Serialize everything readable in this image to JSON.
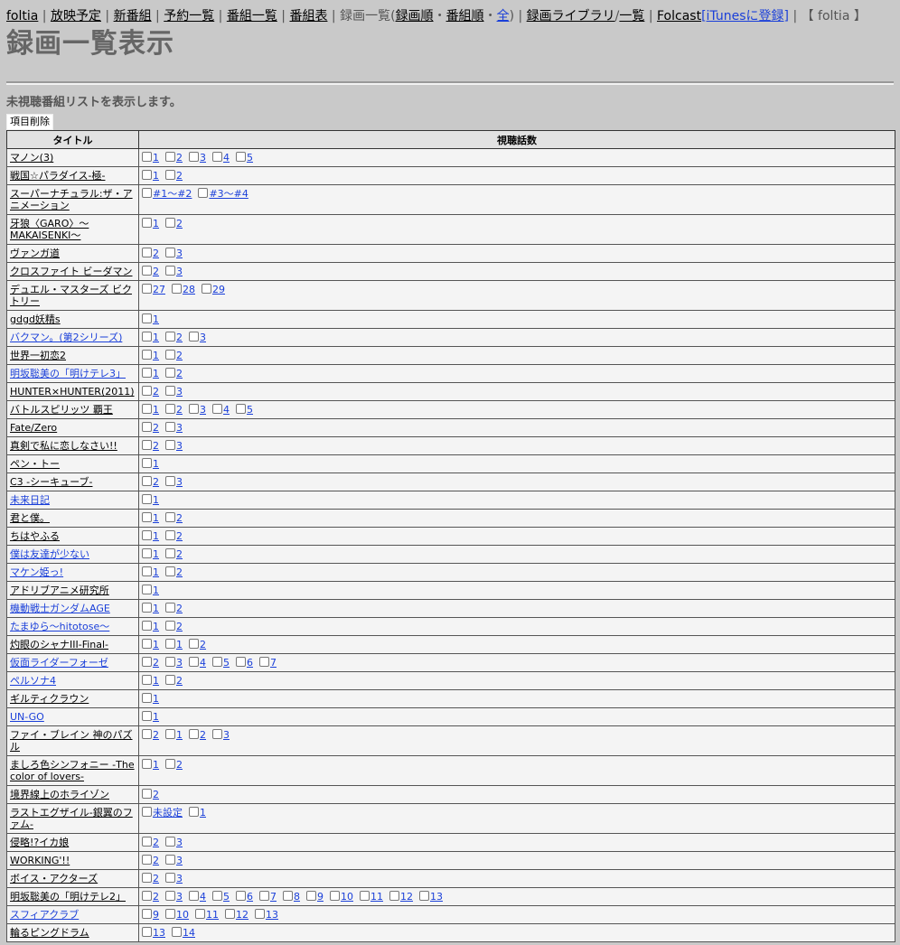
{
  "nav": {
    "items": [
      {
        "label": "foltia",
        "link": true
      },
      {
        "label": "放映予定",
        "link": true
      },
      {
        "label": "新番組",
        "link": true
      },
      {
        "label": "予約一覧",
        "link": true
      },
      {
        "label": "番組一覧",
        "link": true
      },
      {
        "label": "番組表",
        "link": true
      }
    ],
    "rec_list_prefix": "録画一覧(",
    "rec_order": "録画順",
    "dot1": "・",
    "program_order": "番組順",
    "dot2": "・",
    "all": "全",
    "rec_list_suffix": ")",
    "library": "録画ライブラリ",
    "slash": "/",
    "list": "一覧",
    "folcast": "Folcast",
    "itunes_open": "[",
    "itunes": "iTunesに登録",
    "itunes_close": "]",
    "brand": "【 foltia 】"
  },
  "page_title": "録画一覧表示",
  "description": "未視聴番組リストを表示します。",
  "delete_button": "項目削除",
  "table": {
    "col_title": "タイトル",
    "col_episodes": "視聴話数",
    "rows": [
      {
        "title": "マノン(3)",
        "blue": false,
        "eps": [
          "1",
          "2",
          "3",
          "4",
          "5"
        ]
      },
      {
        "title": "戦国☆パラダイス-極-",
        "blue": false,
        "eps": [
          "1",
          "2"
        ]
      },
      {
        "title": "スーパーナチュラル:ザ・アニメーション",
        "blue": false,
        "eps": [
          "#1〜#2",
          "#3〜#4"
        ]
      },
      {
        "title": "牙狼〈GARO〉〜MAKAISENKI〜",
        "blue": false,
        "eps": [
          "1",
          "2"
        ]
      },
      {
        "title": "ヴァンガ道",
        "blue": false,
        "eps": [
          "2",
          "3"
        ]
      },
      {
        "title": "クロスファイト ビーダマン",
        "blue": false,
        "eps": [
          "2",
          "3"
        ]
      },
      {
        "title": "デュエル・マスターズ ビクトリー",
        "blue": false,
        "eps": [
          "27",
          "28",
          "29"
        ]
      },
      {
        "title": "gdgd妖精s",
        "blue": false,
        "eps": [
          "1"
        ]
      },
      {
        "title": "バクマン。(第2シリーズ)",
        "blue": true,
        "eps": [
          "1",
          "2",
          "3"
        ]
      },
      {
        "title": "世界一初恋2",
        "blue": false,
        "eps": [
          "1",
          "2"
        ]
      },
      {
        "title": "明坂聡美の「明けテレ3」",
        "blue": true,
        "eps": [
          "1",
          "2"
        ]
      },
      {
        "title": "HUNTER×HUNTER(2011)",
        "blue": false,
        "eps": [
          "2",
          "3"
        ]
      },
      {
        "title": "バトルスピリッツ 覇王",
        "blue": false,
        "eps": [
          "1",
          "2",
          "3",
          "4",
          "5"
        ]
      },
      {
        "title": "Fate/Zero",
        "blue": false,
        "eps": [
          "2",
          "3"
        ]
      },
      {
        "title": "真剣で私に恋しなさい!!",
        "blue": false,
        "eps": [
          "2",
          "3"
        ]
      },
      {
        "title": "ペン・トー",
        "blue": false,
        "eps": [
          "1"
        ]
      },
      {
        "title": "C3 -シーキューブ-",
        "blue": false,
        "eps": [
          "2",
          "3"
        ]
      },
      {
        "title": "未来日記",
        "blue": true,
        "eps": [
          "1"
        ]
      },
      {
        "title": "君と僕。",
        "blue": false,
        "eps": [
          "1",
          "2"
        ]
      },
      {
        "title": "ちはやふる",
        "blue": false,
        "eps": [
          "1",
          "2"
        ]
      },
      {
        "title": "僕は友達が少ない",
        "blue": true,
        "eps": [
          "1",
          "2"
        ]
      },
      {
        "title": "マケン姫っ!",
        "blue": true,
        "eps": [
          "1",
          "2"
        ]
      },
      {
        "title": "アドリブアニメ研究所",
        "blue": false,
        "eps": [
          "1"
        ]
      },
      {
        "title": "機動戦士ガンダムAGE",
        "blue": true,
        "eps": [
          "1",
          "2"
        ]
      },
      {
        "title": "たまゆら〜hitotose〜",
        "blue": true,
        "eps": [
          "1",
          "2"
        ]
      },
      {
        "title": "灼眼のシャナIII-Final-",
        "blue": false,
        "eps": [
          "1",
          "1",
          "2"
        ]
      },
      {
        "title": "仮面ライダーフォーゼ",
        "blue": true,
        "eps": [
          "2",
          "3",
          "4",
          "5",
          "6",
          "7"
        ]
      },
      {
        "title": "ペルソナ4",
        "blue": true,
        "eps": [
          "1",
          "2"
        ]
      },
      {
        "title": "ギルティクラウン",
        "blue": false,
        "eps": [
          "1"
        ]
      },
      {
        "title": "UN-GO",
        "blue": true,
        "eps": [
          "1"
        ]
      },
      {
        "title": "ファイ・ブレイン 神のパズル",
        "blue": false,
        "eps": [
          "2",
          "1",
          "2",
          "3"
        ]
      },
      {
        "title": "ましろ色シンフォニー -The color of lovers-",
        "blue": false,
        "eps": [
          "1",
          "2"
        ]
      },
      {
        "title": "境界線上のホライゾン",
        "blue": false,
        "eps": [
          "2"
        ]
      },
      {
        "title": "ラストエグザイル-銀翼のファム-",
        "blue": false,
        "eps": [
          "未設定",
          "1"
        ]
      },
      {
        "title": "侵略!?イカ娘",
        "blue": false,
        "eps": [
          "2",
          "3"
        ]
      },
      {
        "title": "WORKING'!!",
        "blue": false,
        "eps": [
          "2",
          "3"
        ]
      },
      {
        "title": "ボイス・アクターズ",
        "blue": false,
        "eps": [
          "2",
          "3"
        ]
      },
      {
        "title": "明坂聡美の「明けテレ2」",
        "blue": false,
        "eps": [
          "2",
          "3",
          "4",
          "5",
          "6",
          "7",
          "8",
          "9",
          "10",
          "11",
          "12",
          "13"
        ]
      },
      {
        "title": "スフィアクラブ",
        "blue": true,
        "eps": [
          "9",
          "10",
          "11",
          "12",
          "13"
        ]
      },
      {
        "title": "輪るピングドラム",
        "blue": false,
        "eps": [
          "13",
          "14"
        ]
      }
    ]
  }
}
